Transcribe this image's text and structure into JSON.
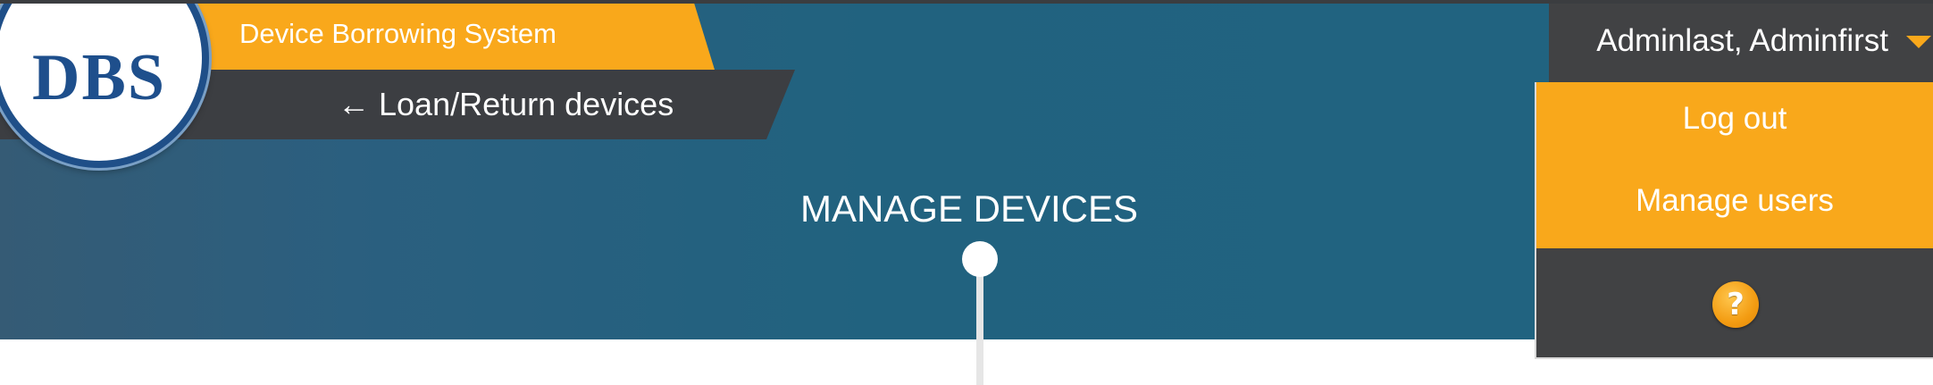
{
  "app": {
    "logo_text": "DBS",
    "system_title": "Device Borrowing System",
    "back_link": "← Loan/Return devices"
  },
  "page": {
    "title": "MANAGE DEVICES"
  },
  "user_menu": {
    "user_name": "Adminlast, Adminfirst",
    "items": [
      {
        "label": "Log out"
      },
      {
        "label": "Manage users"
      }
    ],
    "help_icon": "question-mark-icon",
    "help_glyph": "?"
  },
  "colors": {
    "accent_orange": "#f9a81b",
    "header_teal": "#21627f",
    "dark_gray": "#414244",
    "logo_blue": "#1e4f8c"
  }
}
